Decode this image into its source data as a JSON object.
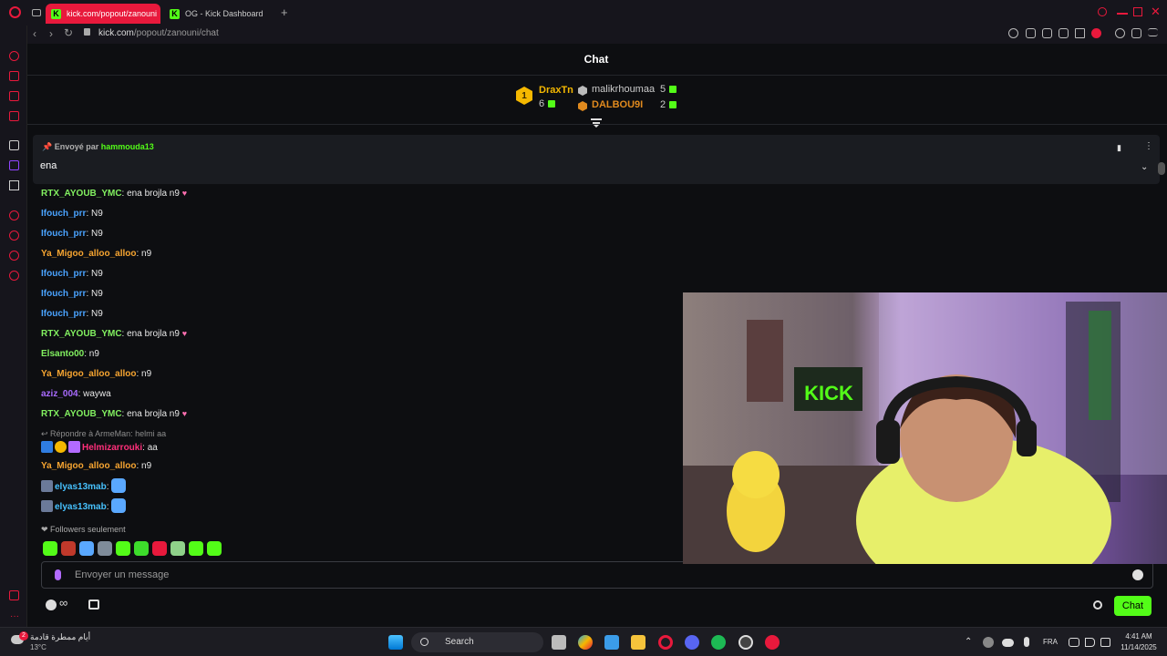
{
  "browser": {
    "tabs": [
      {
        "label": "kick.com/popout/zanouni"
      },
      {
        "label": "OG - Kick Dashboard"
      }
    ],
    "new_tab": "+",
    "url_host": "kick.com",
    "url_path": "/popout/zanouni/chat"
  },
  "chat": {
    "title": "Chat",
    "leaderboard": [
      {
        "rank": "1",
        "name": "DraxTn",
        "count": "6"
      },
      {
        "name": "malikrhoumaa",
        "count": "5"
      },
      {
        "name": "DALBOU9I",
        "count": "2"
      }
    ],
    "pinned": {
      "by_label": "Envoyé par",
      "by_user": "hammouda13",
      "message": "ena"
    },
    "messages": [
      {
        "user": "RTX_AYOUB_YMC",
        "text": ": ena brojla n9"
      },
      {
        "user": "Ifouch_prr",
        "text": ": N9"
      },
      {
        "user": "Ifouch_prr",
        "text": ": N9"
      },
      {
        "user": "Ya_Migoo_alloo_alloo",
        "text": ": n9"
      },
      {
        "user": "Ifouch_prr",
        "text": ": N9"
      },
      {
        "user": "Ifouch_prr",
        "text": ": N9"
      },
      {
        "user": "Ifouch_prr",
        "text": ": N9"
      },
      {
        "user": "RTX_AYOUB_YMC",
        "text": ": ena brojla n9"
      },
      {
        "user": "Elsanto00",
        "text": ": n9"
      },
      {
        "user": "Ya_Migoo_alloo_alloo",
        "text": ": n9"
      },
      {
        "user": "aziz_004",
        "text": ": waywa"
      },
      {
        "user": "RTX_AYOUB_YMC",
        "text": ": ena brojla n9"
      }
    ],
    "reply": {
      "context": "Répondre à ArmeMan: helmi aa",
      "user": "Helmizarrouki",
      "text": ": aa"
    },
    "messages_after": [
      {
        "user": "Ya_Migoo_alloo_alloo",
        "text": ": n9"
      },
      {
        "user": "elyas13mab",
        "text": ":"
      },
      {
        "user": "elyas13mab",
        "text": ":"
      }
    ],
    "followers_only": "Followers seulement",
    "composer_placeholder": "Envoyer un message",
    "send_label": "Chat"
  },
  "webcam": {
    "sign_text": "KICK"
  },
  "taskbar": {
    "weather_text": "أيام ممطرة قادمة",
    "temperature": "13°C",
    "weather_badge": "2",
    "search_label": "Search",
    "language": "FRA",
    "time": "4:41 AM",
    "date": "11/14/2025"
  },
  "colors": {
    "kick_green": "#53fc18",
    "opera_red": "#e8193c"
  }
}
